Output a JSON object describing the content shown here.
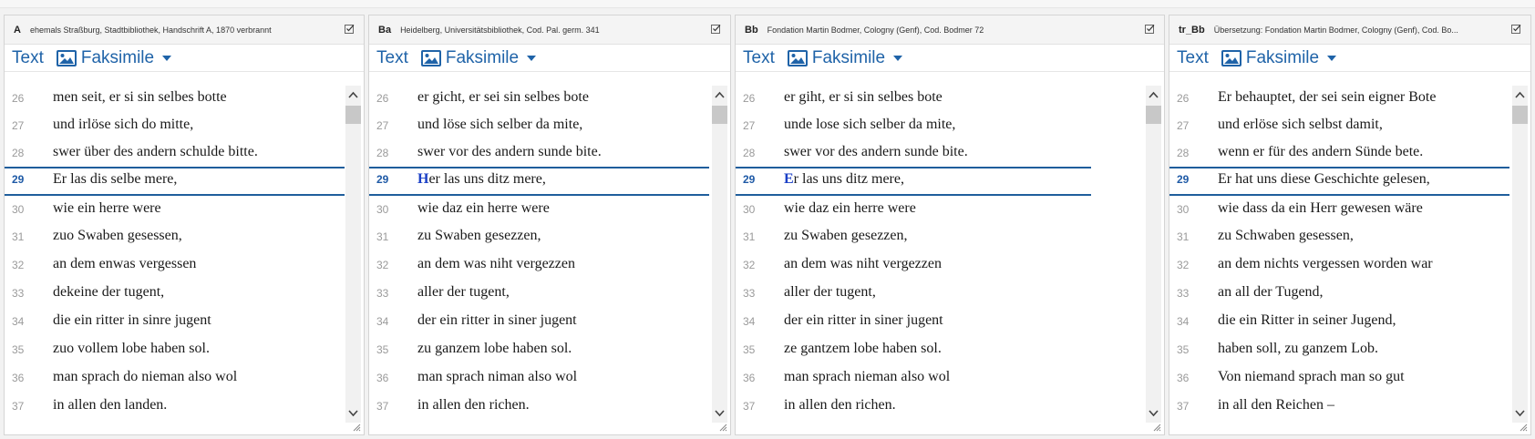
{
  "tab_text": "Text",
  "tab_facsimile": "Faksimile",
  "panels": [
    {
      "siglum": "A",
      "description": "ehemals Straßburg, Stadtbibliothek, Handschrift A, 1870 verbrannt",
      "active_initial": "",
      "active_rest": "Er las dis selbe mere,",
      "lines": [
        {
          "n": "26",
          "t": "men seit, er si sin selbes botte"
        },
        {
          "n": "27",
          "t": "und irlöse sich do mitte,"
        },
        {
          "n": "28",
          "t": "swer über des andern schulde bitte."
        },
        {
          "n": "29",
          "t": "Er las dis selbe mere,"
        },
        {
          "n": "30",
          "t": "wie ein herre were"
        },
        {
          "n": "31",
          "t": "zuo Swaben gesessen,"
        },
        {
          "n": "32",
          "t": "an dem enwas vergessen"
        },
        {
          "n": "33",
          "t": "dekeine der tugent,"
        },
        {
          "n": "34",
          "t": "die ein ritter in sinre jugent"
        },
        {
          "n": "35",
          "t": "zuo vollem lobe haben sol."
        },
        {
          "n": "36",
          "t": "man sprach do nieman also wol"
        },
        {
          "n": "37",
          "t": "in allen den landen."
        }
      ]
    },
    {
      "siglum": "Ba",
      "description": "Heidelberg, Universitätsbibliothek, Cod. Pal. germ. 341",
      "active_initial": "H",
      "active_rest": "er las uns ditz mere,",
      "lines": [
        {
          "n": "26",
          "t": "er gicht, er sei sin selbes bote"
        },
        {
          "n": "27",
          "t": "und löse sich selber da mite,"
        },
        {
          "n": "28",
          "t": "swer vor des andern sunde bite."
        },
        {
          "n": "29",
          "t": "Her las uns ditz mere,"
        },
        {
          "n": "30",
          "t": "wie daz ein herre were"
        },
        {
          "n": "31",
          "t": "zu Swaben gesezzen,"
        },
        {
          "n": "32",
          "t": "an dem was niht vergezzen"
        },
        {
          "n": "33",
          "t": "aller der tugent,"
        },
        {
          "n": "34",
          "t": "der ein ritter in siner jugent"
        },
        {
          "n": "35",
          "t": "zu ganzem lobe haben sol."
        },
        {
          "n": "36",
          "t": "man sprach niman also wol"
        },
        {
          "n": "37",
          "t": "in allen den richen."
        }
      ]
    },
    {
      "siglum": "Bb",
      "description": "Fondation Martin Bodmer, Cologny (Genf), Cod. Bodmer 72",
      "active_initial": "E",
      "active_rest": "r las uns ditz mere,",
      "lines": [
        {
          "n": "26",
          "t": "er giht, er si sin selbes bote"
        },
        {
          "n": "27",
          "t": "unde lose sich selber da mite,"
        },
        {
          "n": "28",
          "t": "swer vor des andern sunde bite."
        },
        {
          "n": "29",
          "t": "Er las uns ditz mere,"
        },
        {
          "n": "30",
          "t": "wie daz ein herre were"
        },
        {
          "n": "31",
          "t": "zu Swaben gesezzen,"
        },
        {
          "n": "32",
          "t": "an dem was niht vergezzen"
        },
        {
          "n": "33",
          "t": "aller der tugent,"
        },
        {
          "n": "34",
          "t": "der ein ritter in siner jugent"
        },
        {
          "n": "35",
          "t": "ze gantzem lobe haben sol."
        },
        {
          "n": "36",
          "t": "man sprach nieman also wol"
        },
        {
          "n": "37",
          "t": "in allen den richen."
        }
      ]
    },
    {
      "siglum": "tr_Bb",
      "description": "Übersetzung: Fondation Martin Bodmer, Cologny (Genf), Cod. Bo...",
      "active_initial": "",
      "active_rest": "Er hat uns diese Geschichte gelesen,",
      "lines": [
        {
          "n": "26",
          "t": "Er behauptet, der sei sein eigner Bote"
        },
        {
          "n": "27",
          "t": "und erlöse sich selbst damit,"
        },
        {
          "n": "28",
          "t": "wenn er für des andern Sünde bete."
        },
        {
          "n": "29",
          "t": "Er hat uns diese Geschichte gelesen,"
        },
        {
          "n": "30",
          "t": "wie dass da ein Herr gewesen wäre"
        },
        {
          "n": "31",
          "t": "zu Schwaben gesessen,"
        },
        {
          "n": "32",
          "t": "an dem nichts vergessen worden war"
        },
        {
          "n": "33",
          "t": "an all der Tugend,"
        },
        {
          "n": "34",
          "t": "die ein Ritter in seiner Jugend,"
        },
        {
          "n": "35",
          "t": "haben soll, zu ganzem Lob."
        },
        {
          "n": "36",
          "t": "Von niemand sprach man so gut"
        },
        {
          "n": "37",
          "t": "in all den Reichen –"
        }
      ]
    }
  ],
  "colors": {
    "link_blue": "#1f63a8",
    "active_rule": "#1f5e9c",
    "initial_blue": "#1a3fc6"
  }
}
